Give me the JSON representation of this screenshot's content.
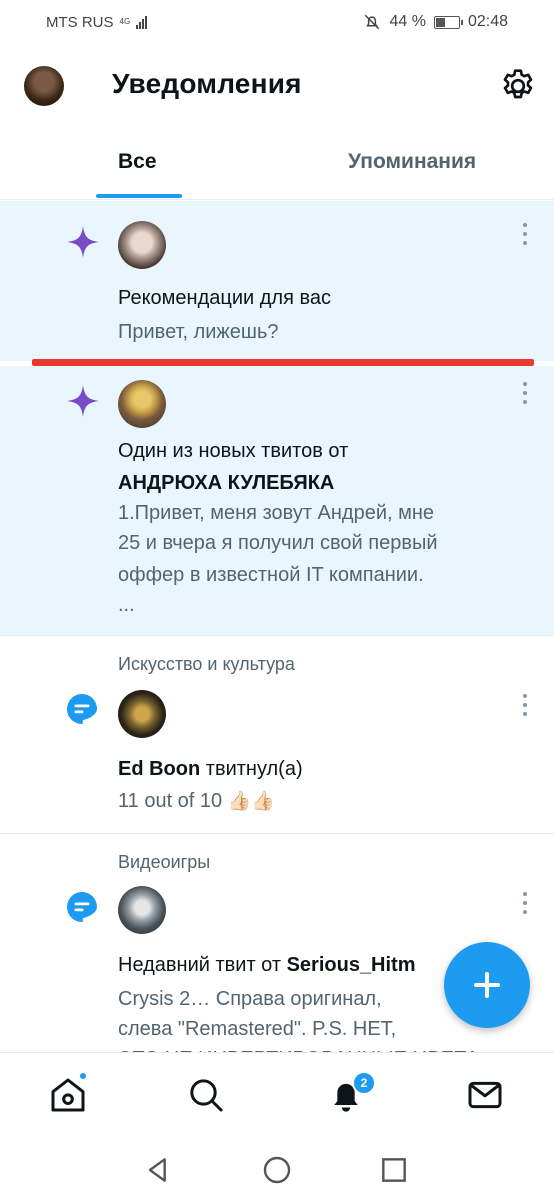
{
  "status_bar": {
    "carrier": "MTS RUS",
    "network": "4G",
    "battery": "44 %",
    "battery_level": 0.44,
    "time": "02:48"
  },
  "header": {
    "title": "Уведомления"
  },
  "tabs": [
    {
      "label": "Все",
      "active": true
    },
    {
      "label": "Упоминания",
      "active": false
    }
  ],
  "notifications": [
    {
      "icon": "sparkle-icon",
      "title": "Рекомендации для вас",
      "subtitle": "Привет, лижешь?"
    },
    {
      "icon": "sparkle-icon",
      "title_prefix": "Один из новых твитов от",
      "author": "АНДРЮХА КУЛЕБЯКА",
      "lines": [
        "1.Привет, меня зовут Андрей, мне",
        "25 и вчера я получил свой первый",
        "оффер в известной IT компании.",
        "..."
      ]
    },
    {
      "icon": "speech-bubble-icon",
      "category": "Искусство и культура",
      "author": "Ed Boon",
      "action": "твитнул(а)",
      "text": "11 out of 10",
      "emoji": "👍🏻👍🏻"
    },
    {
      "icon": "speech-bubble-icon",
      "category": "Видеоигры",
      "title_prefix": "Недавний твит от",
      "author": "Serious_Hitm",
      "lines": [
        "Crysis 2… Справа оригинал,",
        "слева \"Remastered\". P.S. НЕТ,",
        "ЭТО НЕ ИНВЕРТИРОВАННЫЕ ЦВЕТА"
      ]
    }
  ],
  "bottom_nav": {
    "items": [
      "home-icon",
      "search-icon",
      "notifications-icon",
      "messages-icon"
    ],
    "notifications_badge": "2"
  },
  "colors": {
    "accent": "#1d9bf0",
    "highlight_bg": "#eaf6fd",
    "sparkle": "#794bc4",
    "red_line": "#e8392e"
  }
}
